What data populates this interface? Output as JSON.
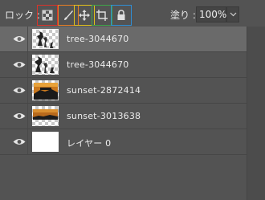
{
  "lock": {
    "label": "ロック :",
    "icons": [
      {
        "name": "lock-transparent-pixels-icon",
        "color": "#d9342b"
      },
      {
        "name": "lock-image-pixels-icon",
        "color": "#e87f24"
      },
      {
        "name": "lock-position-icon",
        "color": "#e3c21c"
      },
      {
        "name": "lock-artboard-icon",
        "color": "#3fa54a"
      },
      {
        "name": "lock-all-icon",
        "color": "#2f8fd6"
      }
    ]
  },
  "fill": {
    "label": "塗り :",
    "value": "100%"
  },
  "layers": [
    {
      "name": "tree-3044670",
      "visible": true,
      "selected": true
    },
    {
      "name": "tree-3044670",
      "visible": true,
      "selected": false
    },
    {
      "name": "sunset-2872414",
      "visible": true,
      "selected": false
    },
    {
      "name": "sunset-3013638",
      "visible": true,
      "selected": false
    },
    {
      "name": "レイヤー 0",
      "visible": true,
      "selected": false
    }
  ]
}
